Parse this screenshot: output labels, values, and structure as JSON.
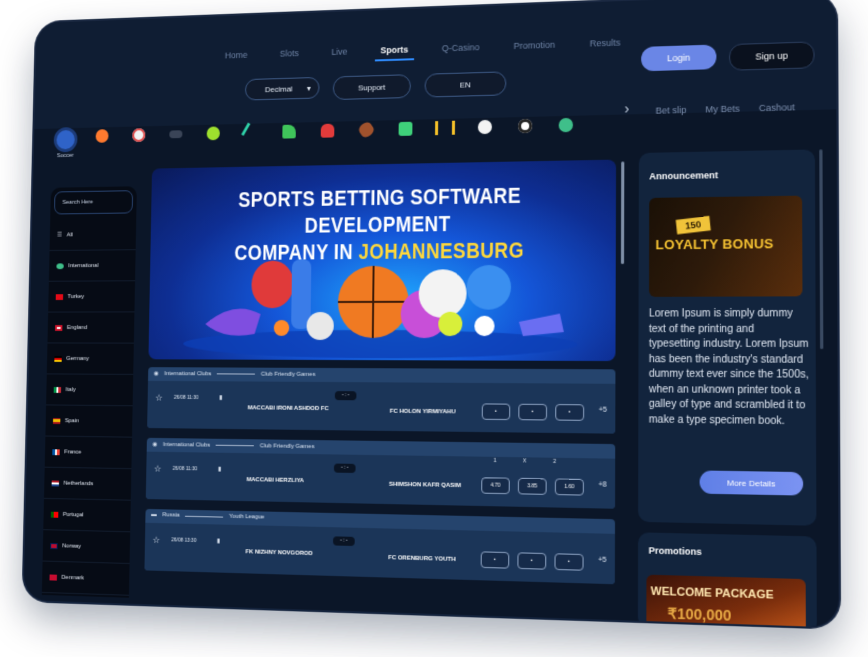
{
  "nav": {
    "links": [
      "Home",
      "Slots",
      "Live",
      "Sports",
      "Q-Casino",
      "Promotion",
      "Results"
    ],
    "active_index": 3
  },
  "controls": {
    "odds_format": "Decimal",
    "support": "Support",
    "language": "EN"
  },
  "auth": {
    "login": "Login",
    "signup": "Sign up"
  },
  "sports_bar": {
    "selected_label": "Soccer",
    "icons": [
      "soccer-icon",
      "basketball-icon",
      "baseball-icon",
      "hockey-puck-icon",
      "tennis-icon",
      "cricket-icon",
      "golf-icon",
      "boxing-icon",
      "american-football-icon",
      "esports-icon",
      "darts-icon",
      "volleyball-icon",
      "football-icon",
      "rugby-icon"
    ]
  },
  "bet_links": [
    "Bet slip",
    "My Bets",
    "Cashout"
  ],
  "sidebar": {
    "search_placeholder": "Search Here",
    "items": [
      "All",
      "International",
      "Turkey",
      "England",
      "Germany",
      "Italy",
      "Spain",
      "France",
      "Netherlands",
      "Portugal",
      "Norway",
      "Denmark"
    ]
  },
  "banner": {
    "line1": "SPORTS BETTING SOFTWARE DEVELOPMENT",
    "line2_prefix": "COMPANY IN ",
    "line2_highlight": "JOHANNESBURG"
  },
  "matches": [
    {
      "league": "International Clubs",
      "competition": "Club Friendly Games",
      "date": "26/08 11:30",
      "score": "- : -",
      "home": "MACCABI IRONI ASHDOD FC",
      "away": "FC HOLON YIRMIYAHU",
      "odds": [
        "",
        "",
        ""
      ],
      "more": "+5"
    },
    {
      "league": "International Clubs",
      "competition": "Club Friendly Games",
      "date": "26/08 11:30",
      "score": "- : -",
      "home": "MACCABI HERZLIYA",
      "away": "SHIMSHON KAFR QASIM",
      "odds_headers": [
        "1",
        "X",
        "2"
      ],
      "odds": [
        "4.70",
        "3.85",
        "1.60"
      ],
      "more": "+8"
    },
    {
      "league": "Russia",
      "competition": "Youth League",
      "date": "26/08 13:30",
      "score": "- : -",
      "home": "FK NIZHNY NOVGOROD",
      "away": "FC ORENBURG YOUTH",
      "odds": [
        "",
        "",
        ""
      ],
      "more": "+5"
    }
  ],
  "announcement": {
    "title": "Announcement",
    "badge": "150",
    "bonus": "LOYALTY BONUS",
    "text": "Lorem Ipsum is simply dummy text of the printing and typesetting industry. Lorem Ipsum has been the industry's standard dummy text ever since the 1500s, when an unknown printer took a galley of type and scrambled it to make a type specimen book.",
    "button": "More Details"
  },
  "promotions": {
    "title": "Promotions",
    "banner_text": "WELCOME PACKAGE",
    "banner_amount": "₹100,000"
  },
  "colors": {
    "accent": "#2f8cff",
    "login": "#6a86e6",
    "match_header": "#25446d",
    "match_body": "#1b3558",
    "highlight": "#ffd83a"
  }
}
